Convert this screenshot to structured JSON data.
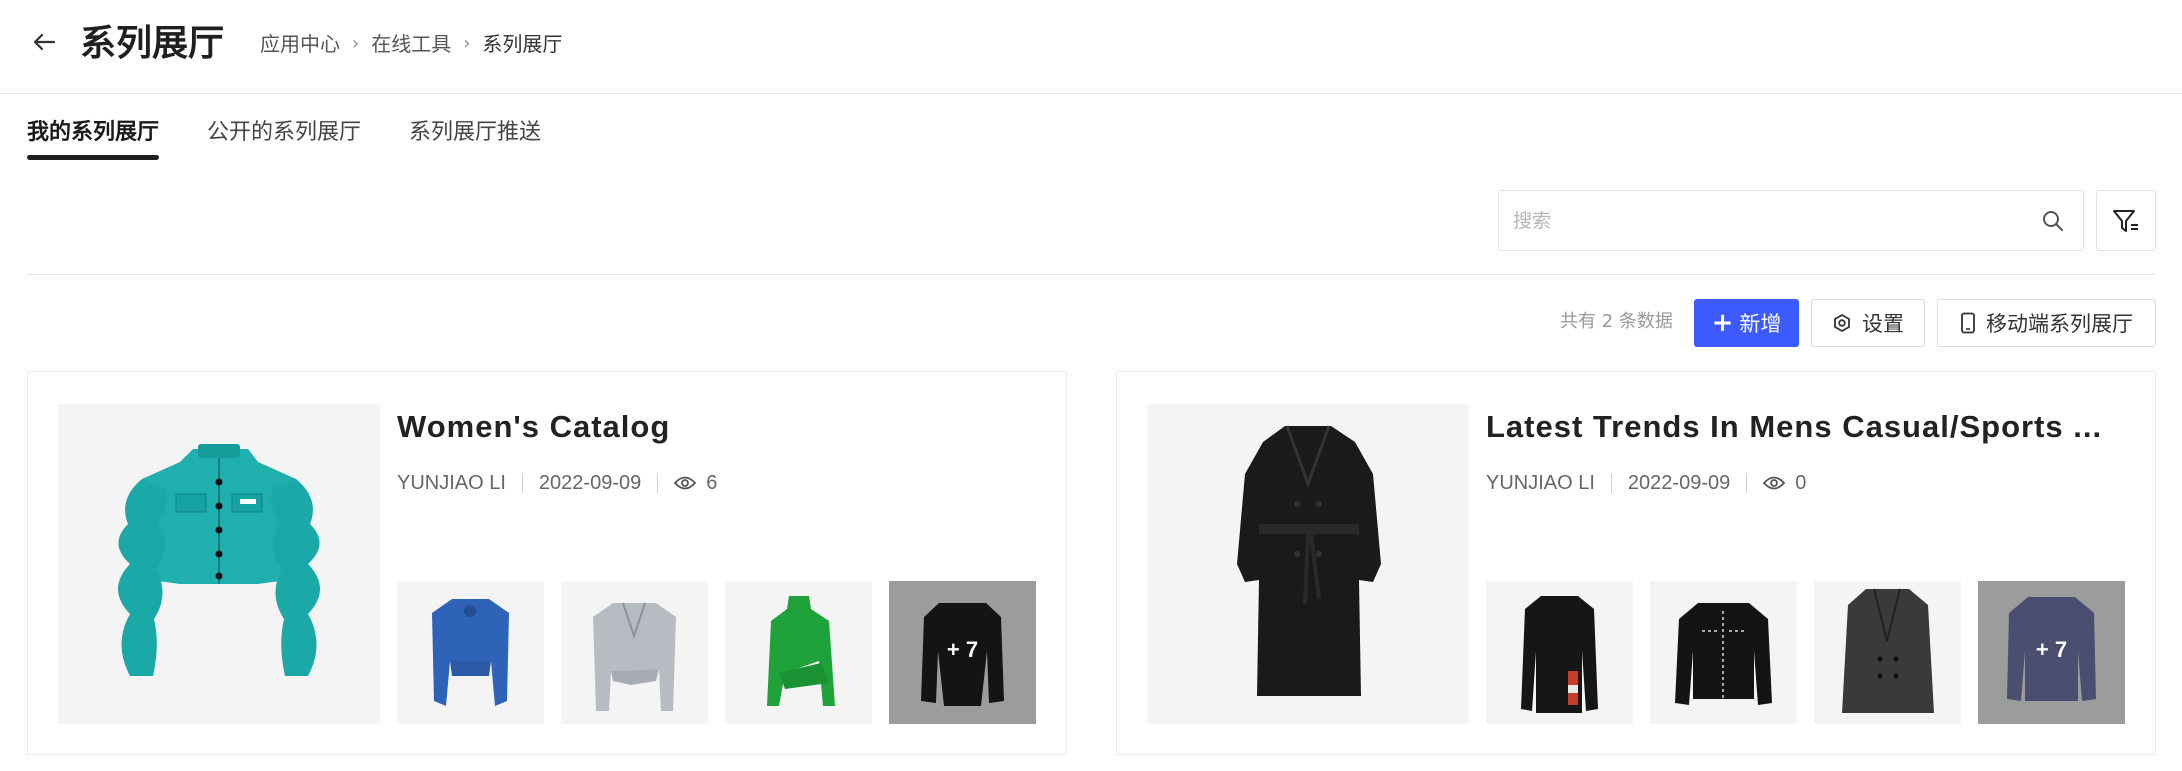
{
  "header": {
    "title": "系列展厅",
    "breadcrumb": [
      "应用中心",
      "在线工具",
      "系列展厅"
    ]
  },
  "tabs": [
    "我的系列展厅",
    "公开的系列展厅",
    "系列展厅推送"
  ],
  "search": {
    "placeholder": "搜索"
  },
  "toolbar": {
    "count_text": "共有 2 条数据",
    "add_label": "新增",
    "settings_label": "设置",
    "mobile_label": "移动端系列展厅"
  },
  "colors": {
    "primary": "#3d5afe",
    "tab_indicator": "#1f1f1f"
  },
  "cards": [
    {
      "title": "Women's Catalog",
      "author": "YUNJIAO  LI",
      "date": "2022-09-09",
      "views": "6",
      "more": "+ 7",
      "cover": "teal cropped jacket with wavy sleeves",
      "thumbs": [
        "blue cropped jacket",
        "grey cropped blazer",
        "green asymmetric top",
        "black jacket"
      ]
    },
    {
      "title": "Latest Trends In Mens Casual/Sports ...",
      "author": "YUNJIAO  LI",
      "date": "2022-09-09",
      "views": "0",
      "more": "+ 7",
      "cover": "black long trench coat",
      "thumbs": [
        "black jacket with patches",
        "black denim jacket",
        "dark double-breasted blazer",
        "navy blazer"
      ]
    }
  ]
}
